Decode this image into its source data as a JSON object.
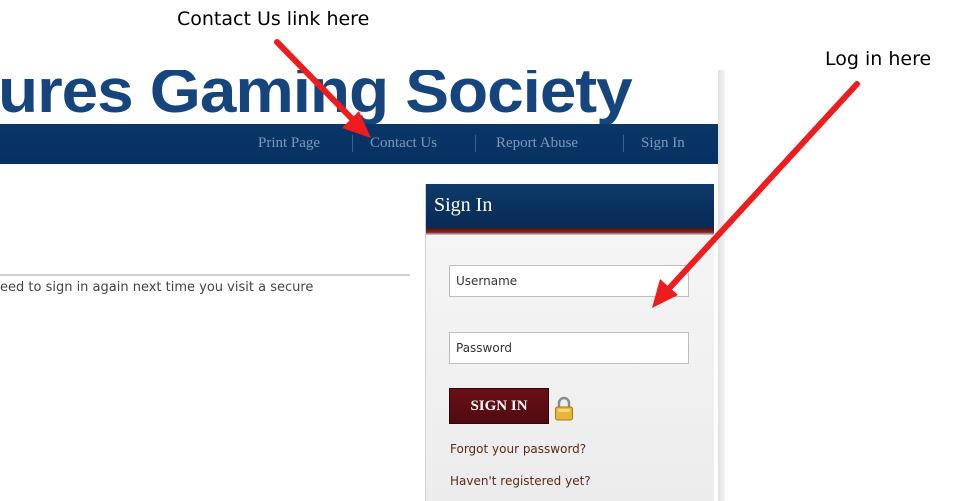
{
  "annotations": {
    "contact": "Contact Us link here",
    "login": "Log in here"
  },
  "site": {
    "title": "ures Gaming Society"
  },
  "nav": {
    "items": [
      "Print Page",
      "Contact Us",
      "Report Abuse",
      "Sign In"
    ]
  },
  "content": {
    "text": "eed to sign in again next time you visit a secure"
  },
  "signin": {
    "title": "Sign In",
    "username_placeholder": "Username",
    "password_placeholder": "Password",
    "button_label": "SIGN IN",
    "forgot_label": "Forgot your password?",
    "register_label": "Haven't registered yet?"
  },
  "colors": {
    "nav_bar": "#063060",
    "title_blue": "#16457e",
    "button_maroon": "#5a0c12",
    "arrow_red": "#ee1c1c"
  }
}
